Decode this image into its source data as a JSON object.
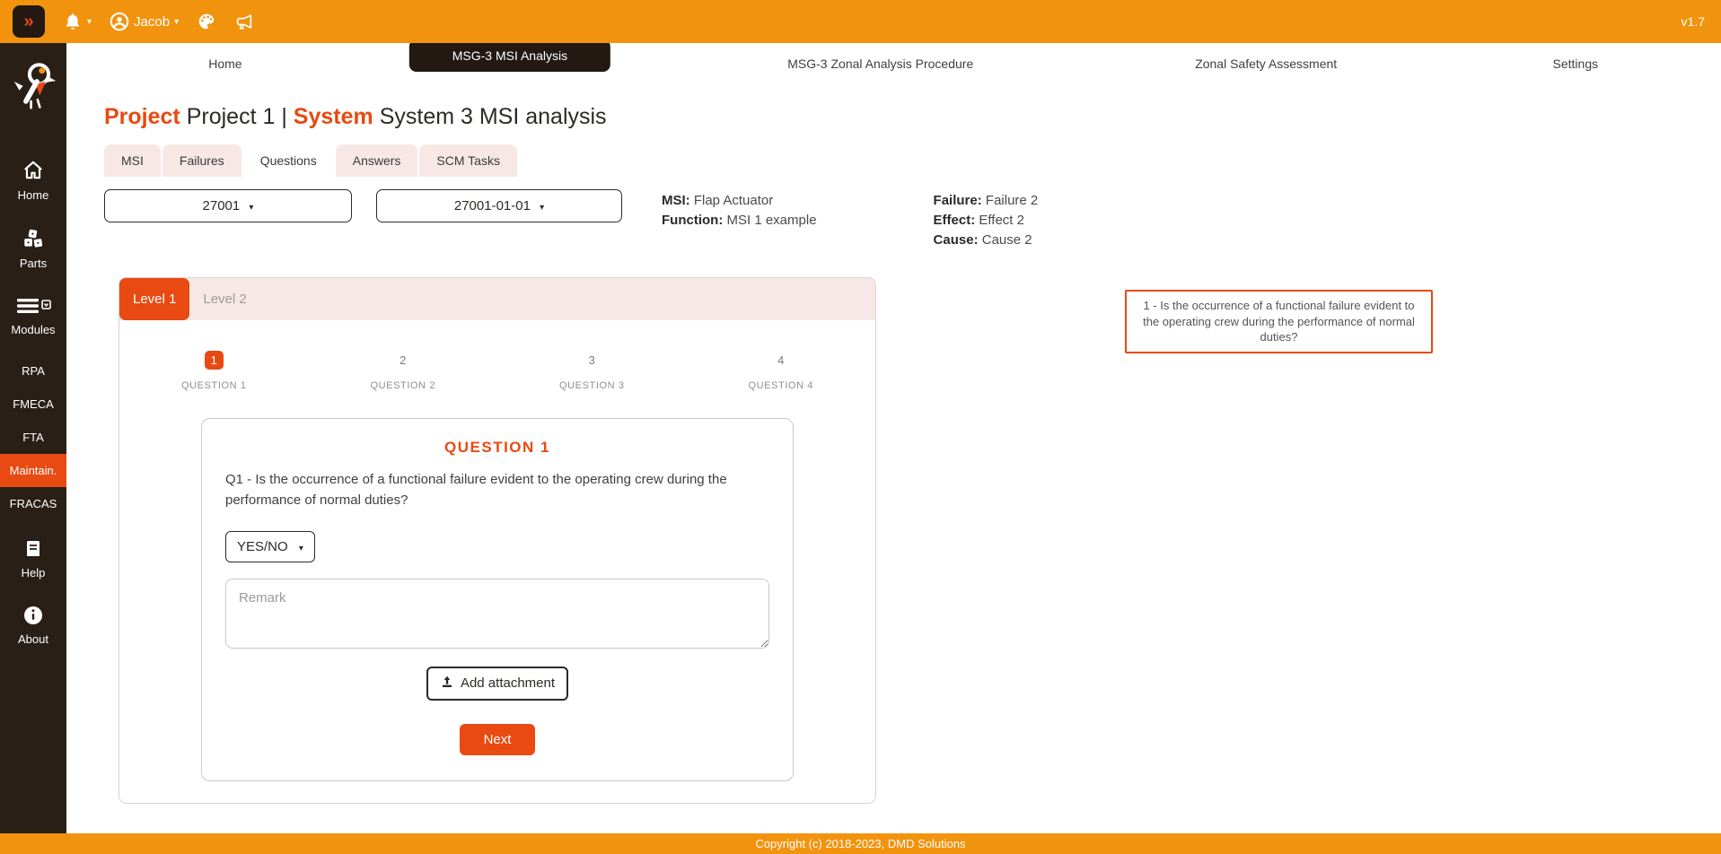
{
  "icons": {
    "caret": "▾",
    "collapse": "»"
  },
  "colors": {
    "topbar": "#F2930E",
    "accent": "#E84A12",
    "sidebar_bg": "#2A1F17",
    "tab_dark": "#231812",
    "pink": "#F7E8E5"
  },
  "topbar": {
    "user": "Jacob",
    "version": "v1.7"
  },
  "nav": {
    "items": [
      {
        "label": "Home"
      },
      {
        "label": "MSG-3 MSI Analysis"
      },
      {
        "label": "MSG-3 Zonal Analysis Procedure"
      },
      {
        "label": "Zonal Safety Assessment"
      },
      {
        "label": "Settings"
      }
    ]
  },
  "sidebar": {
    "items": [
      {
        "label": "Home"
      },
      {
        "label": "Parts"
      },
      {
        "label": "Modules"
      },
      {
        "label": "RPA"
      },
      {
        "label": "FMECA"
      },
      {
        "label": "FTA"
      },
      {
        "label": "Maintain."
      },
      {
        "label": "FRACAS"
      },
      {
        "label": "Help"
      },
      {
        "label": "About"
      }
    ]
  },
  "page": {
    "title": {
      "project_label": "Project",
      "project_value": "Project 1",
      "separator": "|",
      "system_label": "System",
      "system_value": "System 3 MSI analysis"
    },
    "tabs": [
      {
        "label": "MSI"
      },
      {
        "label": "Failures"
      },
      {
        "label": "Questions"
      },
      {
        "label": "Answers"
      },
      {
        "label": "SCM Tasks"
      }
    ],
    "msi_select_value": "27001",
    "failure_select_value": "27001-01-01",
    "info": {
      "msi_label": "MSI:",
      "msi_value": "Flap Actuator",
      "function_label": "Function:",
      "function_value": "MSI 1 example",
      "failure_label": "Failure:",
      "failure_value": "Failure 2",
      "effect_label": "Effect:",
      "effect_value": "Effect 2",
      "cause_label": "Cause:",
      "cause_value": "Cause 2"
    },
    "levels": [
      {
        "label": "Level 1"
      },
      {
        "label": "Level 2"
      }
    ],
    "stepper": [
      {
        "num": "1",
        "label": "QUESTION 1"
      },
      {
        "num": "2",
        "label": "QUESTION 2"
      },
      {
        "num": "3",
        "label": "QUESTION 3"
      },
      {
        "num": "4",
        "label": "QUESTION 4"
      }
    ],
    "question_card": {
      "title": "QUESTION 1",
      "text": "Q1 - Is the occurrence of a functional failure evident to the operating crew during the performance of normal duties?",
      "answer_value": "YES/NO",
      "remark_placeholder": "Remark",
      "add_attachment_label": "Add attachment",
      "next_label": "Next"
    },
    "hint": "1 - Is the occurrence of a functional failure evident to the operating crew during the performance of normal duties?"
  },
  "footer": {
    "copyright": "Copyright (c) 2018-2023, DMD Solutions"
  }
}
